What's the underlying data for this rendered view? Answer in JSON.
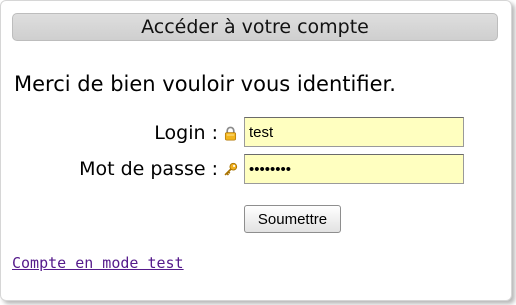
{
  "header": {
    "title": "Accéder à votre compte"
  },
  "intro": {
    "text": "Merci de bien vouloir vous identifier."
  },
  "form": {
    "login_label": "Login :",
    "login_value": "test",
    "login_icon": "lock-icon",
    "password_label": "Mot de passe :",
    "password_value": "testtest",
    "password_icon": "key-icon",
    "submit_label": "Soumettre"
  },
  "footer": {
    "test_link": "Compte en mode test"
  },
  "colors": {
    "field_background": "#ffffc0",
    "header_background": "#d8d8d8",
    "link": "#551a8b"
  }
}
